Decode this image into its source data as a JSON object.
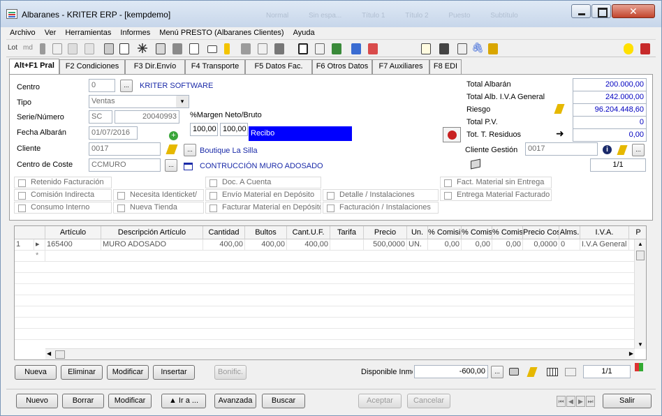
{
  "window": {
    "title": "Albaranes - KRITER ERP -  [kempdemo]",
    "ghost_tabs": [
      "Normal",
      "Sin espa...",
      "Título 1",
      "Título 2",
      "Puesto",
      "Subtítulo"
    ]
  },
  "menu": [
    "Archivo",
    "Ver",
    "Herramientas",
    "Informes",
    "Menú PRESTO (Albaranes Clientes)",
    "Ayuda"
  ],
  "toolbar": {
    "lot_label": "Lot",
    "md_label": "md"
  },
  "tabs": [
    "Alt+F1 Pral",
    "F2 Condiciones",
    "F3 Dir.Envío",
    "F4 Transporte",
    "F5 Datos Fac.",
    "F6 Otros Datos",
    "F7 Auxiliares",
    "F8 EDI"
  ],
  "form": {
    "centro": {
      "label": "Centro",
      "value": "0",
      "name": "KRITER SOFTWARE"
    },
    "tipo": {
      "label": "Tipo",
      "value": "Ventas"
    },
    "serie": {
      "label": "Serie/Número",
      "serie": "SC",
      "numero": "20040993"
    },
    "fecha": {
      "label": "Fecha Albarán",
      "value": "01/07/2016"
    },
    "cliente": {
      "label": "Cliente",
      "value": "0017",
      "name": "Boutique La Silla"
    },
    "coste": {
      "label": "Centro de Coste",
      "value": "CCMURO",
      "name": "CONTRUCCIÓN MURO ADOSADO"
    },
    "margen": {
      "label": "%Margen Neto/Bruto",
      "neto": "100,00",
      "bruto": "100,00",
      "recibo": "Recibo"
    },
    "totals": [
      {
        "label": "Total Albarán",
        "value": "200.000,00"
      },
      {
        "label": "Total Alb. I.V.A General",
        "value": "242.000,00"
      },
      {
        "label": "Riesgo",
        "value": "96.204.448,60"
      },
      {
        "label": "Total P.V.",
        "value": "0"
      },
      {
        "label": "Tot. T. Residuos",
        "value": "0,00"
      }
    ],
    "cliente_gestion": {
      "label": "Cliente Gestión",
      "value": "0017"
    },
    "pager": "1/1"
  },
  "checks": [
    "Retenido Facturación",
    "Doc. A Cuenta",
    "Fact. Material sin Entrega",
    "Comisión Indirecta",
    "Necesita Identicket/",
    "Envío Material en Depósito",
    "Detalle / Instalaciones",
    "Entrega Material Facturado",
    "Consumo Interno",
    "Nueva Tienda",
    "Facturar Material en Depósito",
    "Facturación / Instalaciones"
  ],
  "grid": {
    "headers": [
      "Artículo",
      "Descripción Artículo",
      "Cantidad",
      "Bultos",
      "Cant.U.F.",
      "Tarifa",
      "Precio",
      "Un.",
      "% Comisió",
      "% Comis.",
      "% Comis.",
      "Precio Cost",
      "Alms.",
      "I.V.A.",
      "P"
    ],
    "rows": [
      {
        "num": "1",
        "cells": [
          "165400",
          "MURO ADOSADO",
          "400,00",
          "400,00",
          "400,00",
          "",
          "500,0000",
          "UN.",
          "0,00",
          "0,00",
          "0,00",
          "0,0000",
          "0",
          "I.V.A General",
          ""
        ]
      }
    ],
    "new_row_marker": "*"
  },
  "lines_buttons": [
    "Nueva",
    "Eliminar",
    "Modificar",
    "Insertar",
    "Bonific."
  ],
  "disponible": {
    "label": "Disponible Inme",
    "value": "-600,00",
    "pager": "1/1"
  },
  "bottom_buttons": [
    "Nuevo",
    "Borrar",
    "Modificar",
    "▲ Ir a ...",
    "Avanzada",
    "Buscar",
    "Aceptar",
    "Cancelar",
    "Salir"
  ]
}
